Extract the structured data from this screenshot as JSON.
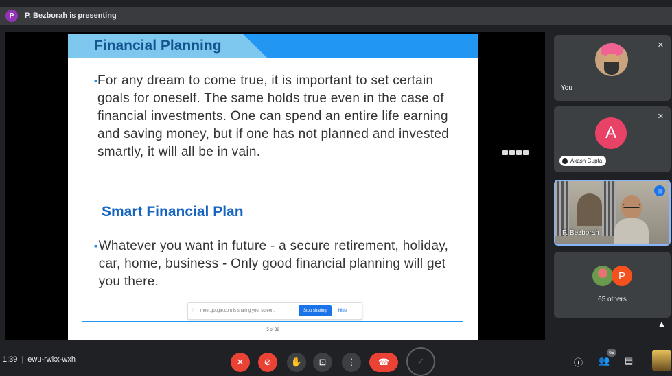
{
  "presenter": {
    "avatar_letter": "P",
    "banner": "P. Bezborah is presenting"
  },
  "slide": {
    "title": "Financial Planning",
    "paragraph1": "For any dream to come true, it is important to set certain goals for oneself. The same holds true even in the case of financial investments. One can spend an entire life earning and saving money, but if one has not planned and invested smartly, it will all be in vain.",
    "subheading": "Smart Financial Plan",
    "paragraph2": "Whatever you want in future - a secure retirement, holiday, car, home, business - Only good financial planning will get you there.",
    "page": "5 of 32",
    "bullet": "▪"
  },
  "share_bar": {
    "message": "meet.google.com is sharing your screen.",
    "stop_label": "Stop sharing",
    "hide_label": "Hide"
  },
  "participants": {
    "you": {
      "label": "You"
    },
    "akash": {
      "avatar_letter": "A",
      "name": "Akash Gupta"
    },
    "presenter_tile": {
      "name": "P. Bezborah"
    },
    "others": {
      "avatar_letter": "P",
      "label": "65 others"
    }
  },
  "meeting": {
    "time": "1:39",
    "separator": "|",
    "code": "ewu-rwkx-wxh",
    "participant_count": "69"
  },
  "icons": {
    "mic_off": "✕",
    "cam_off": "⊘",
    "raise_hand": "✋",
    "present": "⊡",
    "more": "⋮",
    "hangup": "☎",
    "check": "✓",
    "info": "ⓘ",
    "people": "👥",
    "chat": "▤",
    "speaking": "|||",
    "cursor": "▲"
  },
  "colors": {
    "mic_off_red": "#ea4335",
    "slide_title_blue": "#14548f",
    "accent_blue": "#1a73e8",
    "akash_avatar": "#e94267",
    "others_avatar": "#f4511e",
    "presenter_avatar": "#9334b6"
  }
}
